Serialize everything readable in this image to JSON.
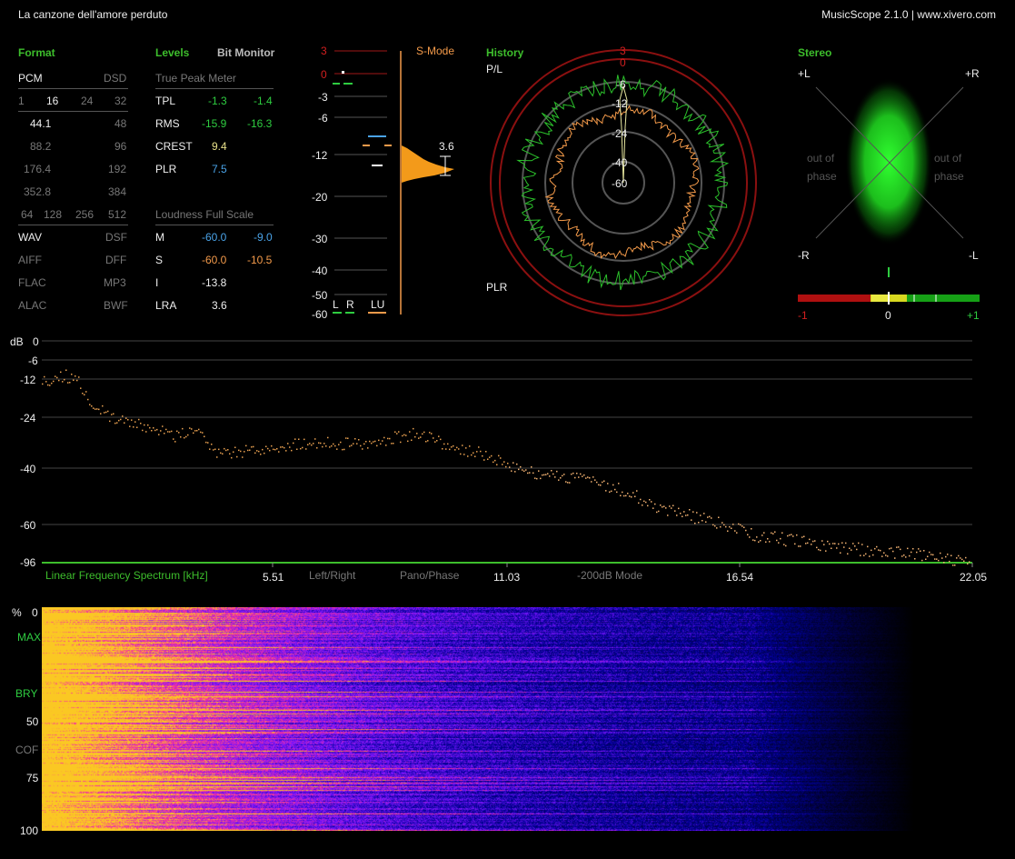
{
  "header": {
    "track_title": "La canzone dell'amore perduto",
    "app_title": "MusicScope 2.1.0 | www.xivero.com"
  },
  "format": {
    "title": "Format",
    "pcm_label": "PCM",
    "dsd_label": "DSD",
    "bit_depths": [
      "1",
      "16",
      "24",
      "32"
    ],
    "pcm_rates": [
      "44.1",
      "88.2",
      "176.4",
      "352.8"
    ],
    "dsd_rates": [
      "48",
      "96",
      "192",
      "384"
    ],
    "dsd_multipliers": [
      "64",
      "128",
      "256",
      "512"
    ],
    "file_left": [
      "WAV",
      "AIFF",
      "FLAC",
      "ALAC"
    ],
    "file_right": [
      "DSF",
      "DFF",
      "MP3",
      "BWF"
    ]
  },
  "levels": {
    "title": "Levels",
    "bit_monitor": "Bit Monitor",
    "true_peak_title": "True Peak Meter",
    "rows": [
      {
        "label": "TPL",
        "l": "-1.3",
        "r": "-1.4"
      },
      {
        "label": "RMS",
        "l": "-15.9",
        "r": "-16.3"
      },
      {
        "label": "CREST",
        "l": "9.4",
        "r": ""
      },
      {
        "label": "PLR",
        "l": "7.5",
        "r": ""
      }
    ],
    "loudness_title": "Loudness Full Scale",
    "loud_rows": [
      {
        "label": "M",
        "a": "-60.0",
        "b": "-9.0"
      },
      {
        "label": "S",
        "a": "-60.0",
        "b": "-10.5"
      },
      {
        "label": "I",
        "a": "-13.8",
        "b": ""
      },
      {
        "label": "LRA",
        "a": "3.6",
        "b": ""
      }
    ]
  },
  "meter": {
    "scale": [
      "3",
      "0",
      "-3",
      "-6",
      "-12",
      "-20",
      "-30",
      "-40",
      "-50",
      "-60"
    ],
    "s_mode": "S-Mode",
    "lra_value": "3.6",
    "l_label": "L",
    "r_label": "R",
    "lu_label": "LU"
  },
  "history": {
    "title": "History",
    "pl_label": "P/L",
    "plr_label": "PLR",
    "ring_labels_red": [
      "3",
      "0"
    ],
    "ring_labels": [
      "-6",
      "-12",
      "-24",
      "-40",
      "-60"
    ]
  },
  "stereo": {
    "title": "Stereo",
    "plus_l": "+L",
    "plus_r": "+R",
    "minus_r": "-R",
    "minus_l": "-L",
    "out_of_phase": "out of phase",
    "corr_labels": [
      "-1",
      "0",
      "+1"
    ],
    "correlation": 0.1
  },
  "spectrum": {
    "db_label": "dB",
    "y_ticks": [
      "0",
      "-6",
      "-12",
      "-24",
      "-40",
      "-60",
      "-96"
    ],
    "title": "Linear Frequency Spectrum [kHz]",
    "x_ticks": [
      "5.51",
      "11.03",
      "16.54",
      "22.05"
    ],
    "left_right": "Left/Right",
    "pano_phase": "Pano/Phase",
    "mode": "-200dB Mode"
  },
  "spectrogram": {
    "y_labels": [
      "%",
      "0",
      "MAX",
      "BRY",
      "50",
      "COF",
      "75",
      "100"
    ]
  },
  "colors": {
    "accent_green": "#3dbe2c",
    "orange": "#f39a4a",
    "red_ring": "#8b1010"
  }
}
